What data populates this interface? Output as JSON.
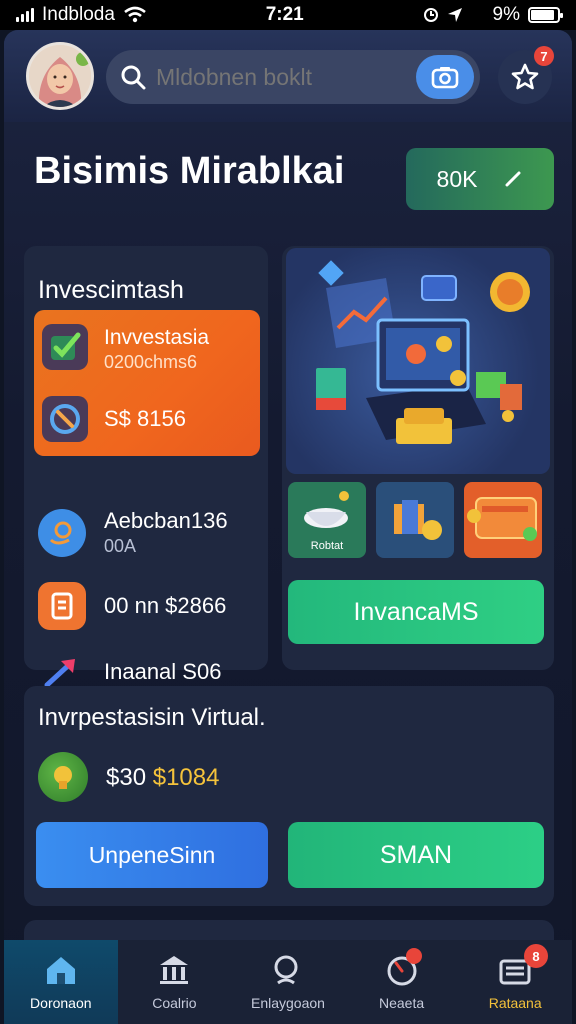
{
  "status": {
    "carrier": "Indbloda",
    "time": "7:21",
    "battery": "9%"
  },
  "header": {
    "search_placeholder": "Mldobnen boklt",
    "notif_count": "7"
  },
  "title": "Bisimis Mirablkai",
  "balance_button": {
    "label": "80K"
  },
  "left_card": {
    "title": "Invescimtash",
    "highlight": {
      "title": "Invvestasia",
      "subtitle": "0200chms6",
      "amount": "S$ 8156"
    },
    "items": [
      {
        "label": "Aebcban136",
        "sub": "00A"
      },
      {
        "label": "00 nn $2866",
        "sub": ""
      },
      {
        "label": "Inaanal S06",
        "sub": ""
      }
    ]
  },
  "right_card": {
    "tile_labels": [
      "Robtat",
      "",
      ""
    ],
    "cta_label": "InvancaMS"
  },
  "bottom_card": {
    "title": "Invrpestasisin Virtual.",
    "amount_white": "$30",
    "amount_gold": "$1084",
    "blue_button": "UnpeneSinn",
    "green_button": "SMAN"
  },
  "tabbar": {
    "tabs": [
      {
        "label": "Doronaon",
        "icon": "home-icon"
      },
      {
        "label": "Coalrio",
        "icon": "bank-icon"
      },
      {
        "label": "Enlaygoaon",
        "icon": "search-icon"
      },
      {
        "label": "Neaeta",
        "icon": "gauge-icon"
      },
      {
        "label": "Rataana",
        "icon": "wallet-icon"
      }
    ],
    "badge": "8"
  },
  "colors": {
    "accent_orange": "#f0661e",
    "accent_green": "#2ccf86",
    "accent_blue": "#3a8ef0",
    "gold": "#f5c33b",
    "badge_red": "#e8453a"
  }
}
